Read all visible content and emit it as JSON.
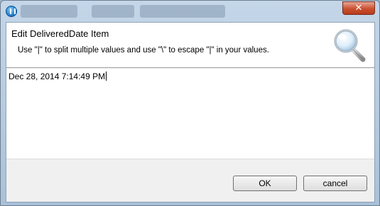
{
  "window": {
    "close_glyph": "✕"
  },
  "dialog": {
    "title": "Edit DeliveredDate Item",
    "message": "Use \"|\" to split multiple values and use \"\\\" to escape \"|\" in your values.",
    "value": "Dec 28, 2014 7:14:49 PM"
  },
  "buttons": {
    "ok_label": "OK",
    "cancel_label": "cancel"
  },
  "icons": {
    "app": "app-icon",
    "header": "magnifier-icon"
  }
}
